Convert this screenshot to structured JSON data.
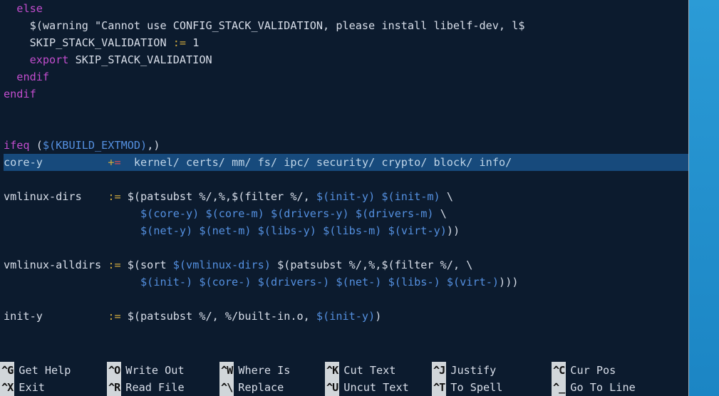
{
  "editor": {
    "file_language": "makefile",
    "lines": {
      "l01a": "  ",
      "l01b": "else",
      "l02": "    $(warning \"Cannot use CONFIG_STACK_VALIDATION, please install libelf-dev, l$",
      "l03a": "    SKIP_STACK_VALIDATION ",
      "l03b": ":=",
      "l03c": " 1",
      "l04a": "    ",
      "l04b": "export",
      "l04c": " SKIP_STACK_VALIDATION",
      "l05a": "  ",
      "l05b": "endif",
      "l06": "endif",
      "l07": "",
      "l08": "",
      "l09a": "ifeq",
      "l09b": " (",
      "l09c": "$(KBUILD_EXTMOD)",
      "l09d": ",)",
      "l10a": "core-y          ",
      "l10b": "+",
      "l10c": "=",
      "l10d": "  kernel/ certs/ mm/ fs/ ipc/ security/ crypto/ block/ info/",
      "l11": "",
      "l12a": "vmlinux-dirs    ",
      "l12b": ":=",
      "l12c": " $(patsubst %/,%,$(filter %/, ",
      "l12d": "$(init-y)",
      "l12e": " ",
      "l12f": "$(init-m)",
      "l12g": " \\",
      "l13a": "                     ",
      "l13b": "$(core-y)",
      "l13c": " ",
      "l13d": "$(core-m)",
      "l13e": " ",
      "l13f": "$(drivers-y)",
      "l13g": " ",
      "l13h": "$(drivers-m)",
      "l13i": " \\",
      "l14a": "                     ",
      "l14b": "$(net-y)",
      "l14c": " ",
      "l14d": "$(net-m)",
      "l14e": " ",
      "l14f": "$(libs-y)",
      "l14g": " ",
      "l14h": "$(libs-m)",
      "l14i": " ",
      "l14j": "$(virt-y)",
      "l14k": "))",
      "l15": "",
      "l16a": "vmlinux-alldirs ",
      "l16b": ":=",
      "l16c": " $(sort ",
      "l16d": "$(vmlinux-dirs)",
      "l16e": " $(patsubst %/,%,$(filter %/, \\",
      "l17a": "                     ",
      "l17b": "$(init-)",
      "l17c": " ",
      "l17d": "$(core-)",
      "l17e": " ",
      "l17f": "$(drivers-)",
      "l17g": " ",
      "l17h": "$(net-)",
      "l17i": " ",
      "l17j": "$(libs-)",
      "l17k": " ",
      "l17l": "$(virt-)",
      "l17m": ")))",
      "l18": "",
      "l19a": "init-y          ",
      "l19b": ":=",
      "l19c": " $(patsubst %/, %/built-in.o, ",
      "l19d": "$(init-y)",
      "l19e": ")",
      "l20": ""
    }
  },
  "shortcuts": {
    "row1": [
      {
        "key": "^G",
        "label": "Get Help"
      },
      {
        "key": "^O",
        "label": "Write Out"
      },
      {
        "key": "^W",
        "label": "Where Is"
      },
      {
        "key": "^K",
        "label": "Cut Text"
      },
      {
        "key": "^J",
        "label": "Justify"
      },
      {
        "key": "^C",
        "label": "Cur Pos"
      }
    ],
    "row2": [
      {
        "key": "^X",
        "label": "Exit"
      },
      {
        "key": "^R",
        "label": "Read File"
      },
      {
        "key": "^\\",
        "label": "Replace"
      },
      {
        "key": "^U",
        "label": "Uncut Text"
      },
      {
        "key": "^T",
        "label": "To Spell"
      },
      {
        "key": "^_",
        "label": "Go To Line"
      }
    ]
  },
  "colors": {
    "bg": "#0c1b2e",
    "keyword": "#c24dcd",
    "var": "#5490e0",
    "op_assign": "#d0aa3f",
    "op_red": "#d94f4f",
    "highlight_bg": "#174a7c",
    "shortcut_key_bg": "#d1d6da"
  }
}
